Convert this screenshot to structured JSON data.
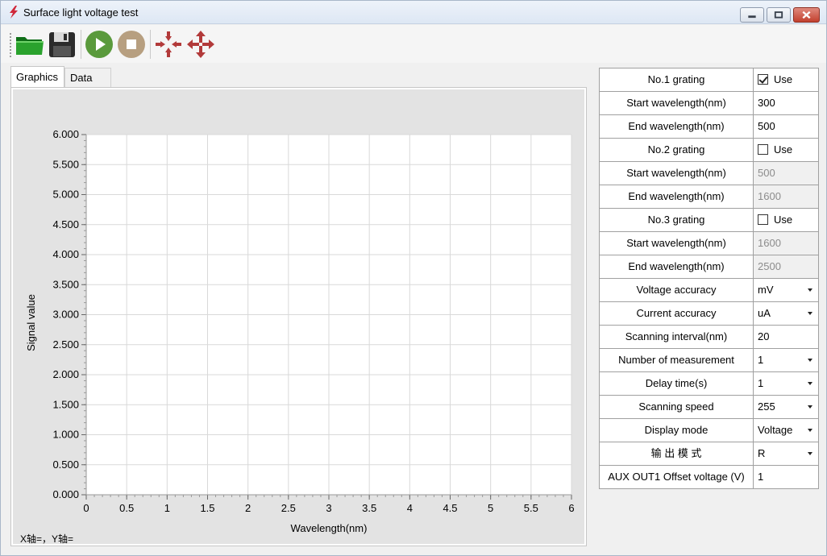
{
  "window": {
    "title": "Surface light voltage test",
    "controls": [
      "minimize",
      "maximize",
      "close"
    ]
  },
  "toolbar": {
    "buttons": [
      {
        "name": "open",
        "icon": "folder-open-icon",
        "color": "#1f8f1f"
      },
      {
        "name": "save",
        "icon": "floppy-disk-icon",
        "color": "#333333"
      },
      {
        "name": "start",
        "icon": "play-icon",
        "color": "#5a9a3c"
      },
      {
        "name": "stop",
        "icon": "stop-icon",
        "color": "#b79f80"
      },
      {
        "name": "zoom-in",
        "icon": "arrows-inward-icon",
        "color": "#b23a3a"
      },
      {
        "name": "move",
        "icon": "arrows-outward-icon",
        "color": "#b23a3a"
      }
    ]
  },
  "tabs": [
    {
      "label": "Graphics",
      "active": true
    },
    {
      "label": "Data",
      "active": false
    }
  ],
  "graph": {
    "status_text": "X轴=，Y轴="
  },
  "chart_data": {
    "type": "line",
    "title": "",
    "xlabel": "Wavelength(nm)",
    "ylabel": "Signal value",
    "xlim": [
      0,
      6
    ],
    "ylim": [
      0,
      6
    ],
    "x_ticks": [
      "0",
      "0.5",
      "1",
      "1.5",
      "2",
      "2.5",
      "3",
      "3.5",
      "4",
      "4.5",
      "5",
      "5.5",
      "6"
    ],
    "y_ticks": [
      "0.000",
      "0.500",
      "1.000",
      "1.500",
      "2.000",
      "2.500",
      "3.000",
      "3.500",
      "4.000",
      "4.500",
      "5.000",
      "5.500",
      "6.000"
    ],
    "grid": true,
    "series": []
  },
  "settings": [
    {
      "label": "No.1 grating",
      "value": "Use",
      "kind": "checkbox",
      "checked": true
    },
    {
      "label": "Start wavelength(nm)",
      "value": "300",
      "kind": "text",
      "disabled": false
    },
    {
      "label": "End wavelength(nm)",
      "value": "500",
      "kind": "text",
      "disabled": false
    },
    {
      "label": "No.2 grating",
      "value": "Use",
      "kind": "checkbox",
      "checked": false
    },
    {
      "label": "Start wavelength(nm)",
      "value": "500",
      "kind": "text",
      "disabled": true
    },
    {
      "label": "End wavelength(nm)",
      "value": "1600",
      "kind": "text",
      "disabled": true
    },
    {
      "label": "No.3 grating",
      "value": "Use",
      "kind": "checkbox",
      "checked": false
    },
    {
      "label": "Start wavelength(nm)",
      "value": "1600",
      "kind": "text",
      "disabled": true
    },
    {
      "label": "End wavelength(nm)",
      "value": "2500",
      "kind": "text",
      "disabled": true
    },
    {
      "label": "Voltage accuracy",
      "value": "mV",
      "kind": "dropdown"
    },
    {
      "label": "Current accuracy",
      "value": "uA",
      "kind": "dropdown"
    },
    {
      "label": "Scanning interval(nm)",
      "value": "20",
      "kind": "text",
      "disabled": false
    },
    {
      "label": "Number of measurement",
      "value": "1",
      "kind": "dropdown"
    },
    {
      "label": "Delay time(s)",
      "value": "1",
      "kind": "dropdown"
    },
    {
      "label": "Scanning speed",
      "value": "255",
      "kind": "dropdown"
    },
    {
      "label": "Display mode",
      "value": "Voltage",
      "kind": "dropdown"
    },
    {
      "label": "输 出 模 式",
      "value": "R",
      "kind": "dropdown"
    },
    {
      "label": "AUX OUT1 Offset voltage (V)",
      "value": "1",
      "kind": "text",
      "disabled": false
    }
  ]
}
